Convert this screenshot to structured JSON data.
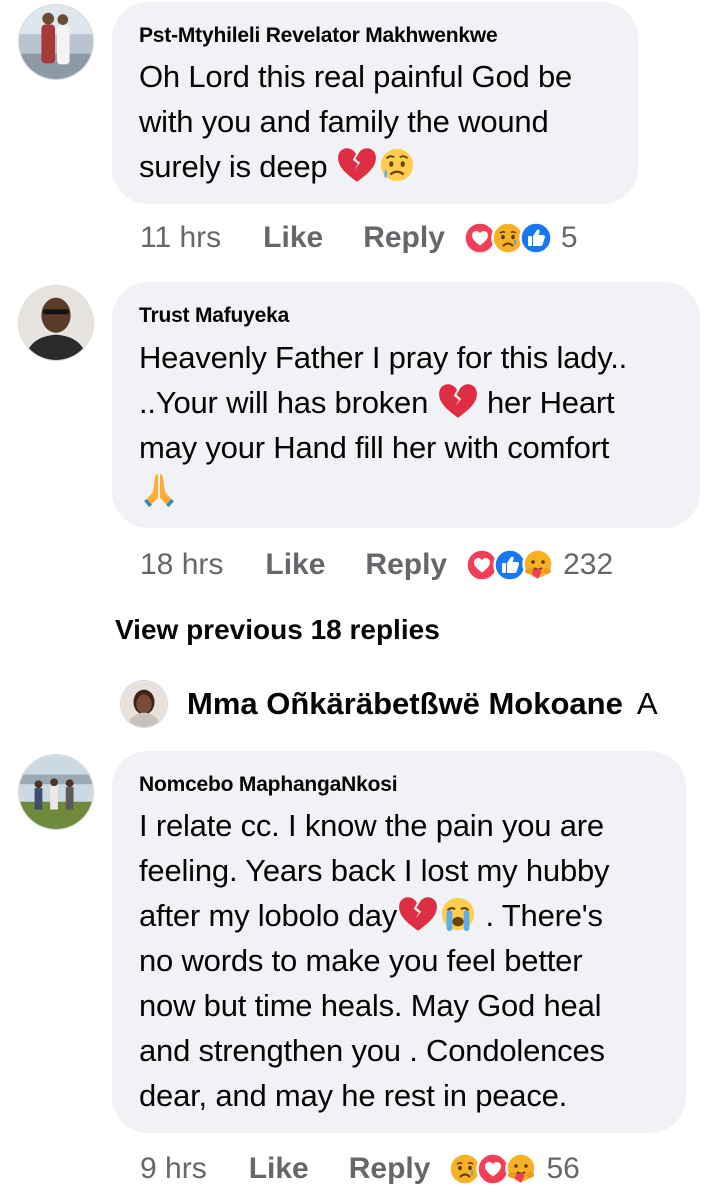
{
  "comments": [
    {
      "author": "Pst-Mtyhileli Revelator Makhwenkwe",
      "lines": [
        "Oh Lord this real painful God be",
        "with you and family the wound",
        "surely is deep"
      ],
      "time": "11 hrs",
      "like": "Like",
      "reply": "Reply",
      "reactions": [
        "love",
        "care-sad",
        "like"
      ],
      "count": "5"
    },
    {
      "author": "Trust Mafuyeka",
      "lines": [
        "Heavenly Father I pray for this lady..",
        "..Your will has broken",
        "may your Hand fill her with comfort"
      ],
      "line2_after": "her Heart",
      "time": "18 hrs",
      "like": "Like",
      "reply": "Reply",
      "reactions": [
        "love",
        "like",
        "care"
      ],
      "count": "232"
    },
    {
      "author": "Nomcebo MaphangaNkosi",
      "lines": [
        "I relate cc. I know the pain you are",
        "feeling. Years back I lost my hubby",
        "after my lobolo day",
        "no words to make you feel better",
        "now but time heals. May God heal",
        "and  strengthen you . Condolences",
        "dear, and may he rest in peace."
      ],
      "line3_after": ". There's",
      "time": "9 hrs",
      "like": "Like",
      "reply": "Reply",
      "reactions": [
        "sad",
        "love",
        "care"
      ],
      "count": "56"
    }
  ],
  "view_previous": "View previous 18 replies",
  "reply_preview": {
    "name": "Mma Oñkäräbetßwë Mokoane",
    "trail": "A"
  },
  "colors": {
    "bubble": "#f0f2f5",
    "meta": "#65676b",
    "like_blue": "#1877f2",
    "love_red": "#f33e58",
    "emoji_yellow": "#f7b125"
  },
  "icons": [
    "broken-heart-icon",
    "sad-tear-icon",
    "praying-hands-icon",
    "crying-face-icon"
  ]
}
